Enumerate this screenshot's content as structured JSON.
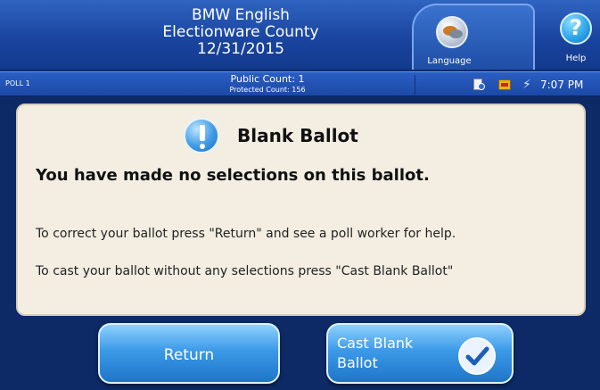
{
  "header": {
    "title_line1": "BMW English",
    "title_line2": "Electionware County",
    "title_line3": "12/31/2015"
  },
  "top_right": {
    "language_label": "Language",
    "language_icon": "speech-bubbles-icon",
    "help_symbol": "?",
    "help_label": "Help"
  },
  "status_bar": {
    "poll_label": "POLL 1",
    "public_count": "Public Count: 1",
    "protected_count": "Protected Count: 156",
    "icons": [
      "document-icon",
      "media-icon",
      "power-plug-icon"
    ],
    "time": "7:07 PM"
  },
  "dialog": {
    "title": "Blank Ballot",
    "heading": "You have made no selections on this ballot.",
    "line1": "To correct your ballot press \"Return\" and see a poll worker for help.",
    "line2": "To cast your ballot without any selections press \"Cast Blank Ballot\""
  },
  "buttons": {
    "return_label": "Return",
    "cast_label_line1": "Cast Blank",
    "cast_label_line2": "Ballot"
  },
  "colors": {
    "header_blue": "#1a45a0",
    "dialog_bg": "#f4eee2",
    "button_blue": "#3b9ae8"
  }
}
